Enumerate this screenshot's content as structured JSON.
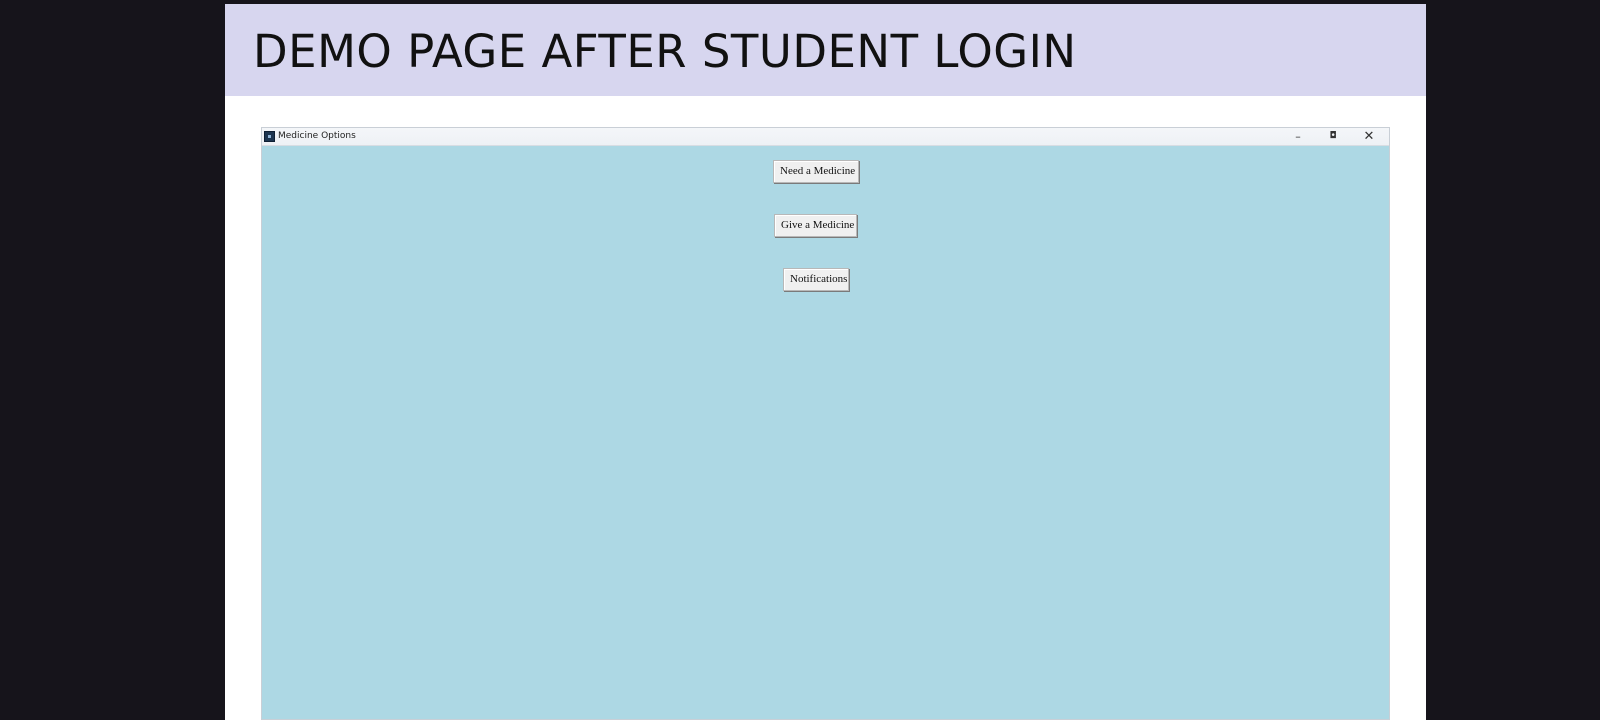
{
  "slide": {
    "title": "DEMO PAGE AFTER STUDENT LOGIN"
  },
  "window": {
    "title": "Medicine Options",
    "icon": "app-icon",
    "controls": {
      "minimize": "–",
      "maximize": "◘",
      "close": "✕"
    },
    "background_color": "#add8e4"
  },
  "buttons": {
    "need_medicine": "Need a Medicine",
    "give_medicine": "Give a Medicine",
    "notifications": "Notifications"
  },
  "colors": {
    "header_band": "#d7d6ef",
    "outer_background": "#16141b"
  }
}
